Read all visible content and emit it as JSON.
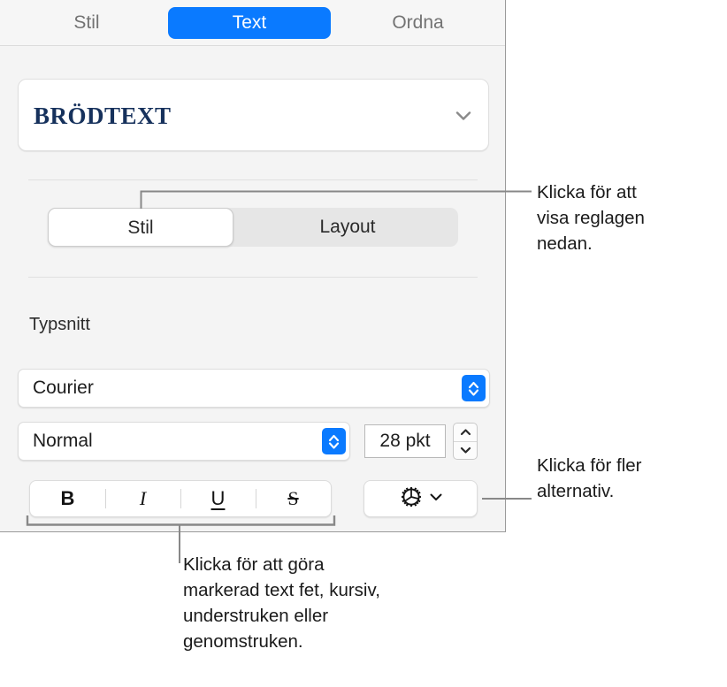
{
  "panel": {
    "tabs": [
      {
        "label": "Stil",
        "selected": false
      },
      {
        "label": "Text",
        "selected": true
      },
      {
        "label": "Ordna",
        "selected": false
      }
    ],
    "paragraph_style": {
      "value": "BRÖDTEXT",
      "chevron_icon": "chevron-down-icon",
      "text_color": "#16315c"
    },
    "section_segmented": {
      "options": [
        {
          "label": "Stil",
          "selected": true
        },
        {
          "label": "Layout",
          "selected": false
        }
      ]
    },
    "font_section": {
      "heading": "Typsnitt",
      "family": {
        "value": "Courier",
        "stepper_icon": "up-down-chevron-icon"
      },
      "weight": {
        "value": "Normal",
        "stepper_icon": "up-down-chevron-icon"
      },
      "size": {
        "value": "28 pkt",
        "stepper_up_icon": "chevron-up-icon",
        "stepper_down_icon": "chevron-down-icon"
      }
    },
    "format_buttons": [
      {
        "label": "B",
        "name": "bold-button"
      },
      {
        "label": "I",
        "name": "italic-button"
      },
      {
        "label": "U",
        "name": "underline-button"
      },
      {
        "label": "S",
        "name": "strikethrough-button"
      }
    ],
    "more_options": {
      "gear_icon": "gear-icon",
      "chevron_icon": "chevron-down-icon"
    }
  },
  "callouts": {
    "top": "Klicka för att\nvisa reglagen\nnedan.",
    "right": "Klicka för fler\nalternativ.",
    "bottom": "Klicka för att göra\nmarkerad text fet, kursiv,\nunderstruken eller\ngenomstruken."
  },
  "colors": {
    "accent_blue": "#0a7aff",
    "panel_background": "#f4f4f4",
    "style_text": "#16315c",
    "leader_line": "#888888"
  }
}
